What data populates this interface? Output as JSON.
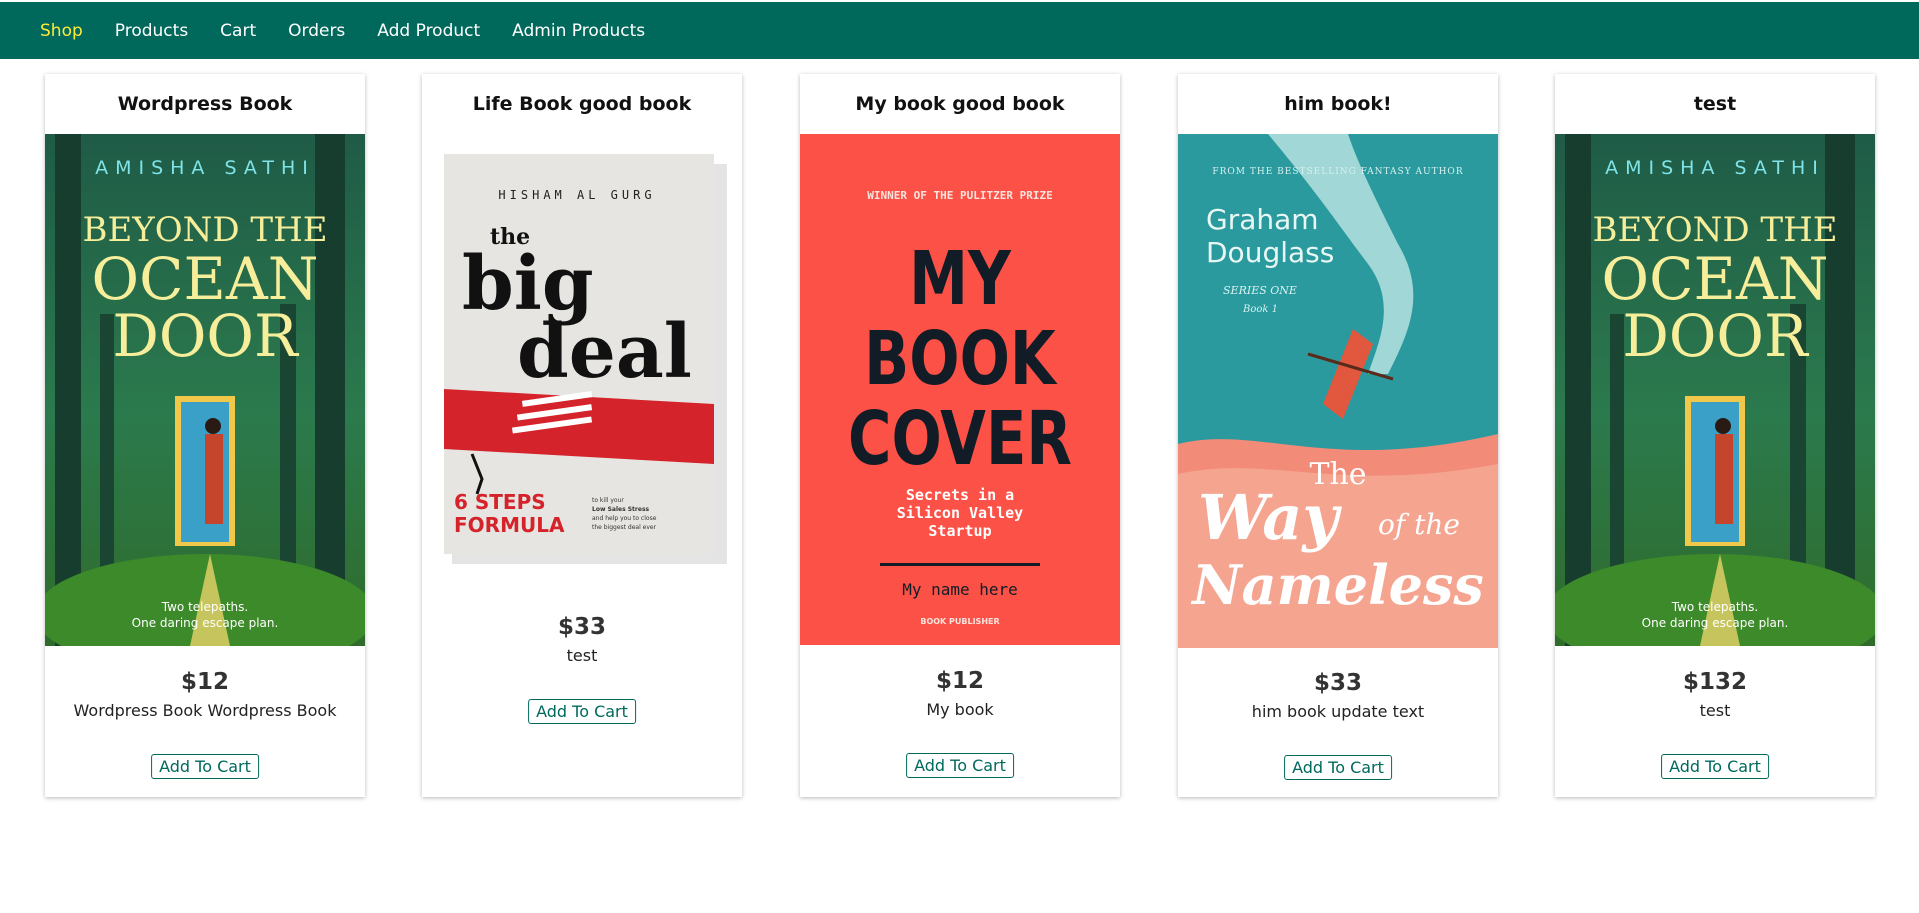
{
  "nav": {
    "items": [
      {
        "label": "Shop",
        "active": true
      },
      {
        "label": "Products",
        "active": false
      },
      {
        "label": "Cart",
        "active": false
      },
      {
        "label": "Orders",
        "active": false
      },
      {
        "label": "Add Product",
        "active": false
      },
      {
        "label": "Admin Products",
        "active": false
      }
    ]
  },
  "colors": {
    "navbar": "#00695c",
    "active_link": "#ffeb3b",
    "button": "#00695c"
  },
  "products": [
    {
      "title": "Wordpress Book",
      "price": "$12",
      "description": "Wordpress Book Wordpress Book",
      "button": "Add To Cart",
      "cover": {
        "author": "AMISHA SATHI",
        "line1": "BEYOND THE",
        "line2": "OCEAN",
        "line3": "DOOR",
        "tagline1": "Two telepaths.",
        "tagline2": "One daring escape plan."
      }
    },
    {
      "title": "Life Book good book",
      "price": "$33",
      "description": "test",
      "button": "Add To Cart",
      "cover": {
        "author": "HISHAM AL GURG",
        "line1": "the",
        "line2": "big",
        "line3": "deal",
        "sub1": "6 STEPS",
        "sub2": "FORMULA",
        "blurb1": "to kill your",
        "blurb2": "Low Sales Stress",
        "blurb3": "and help you to close",
        "blurb4": "the biggest deal ever"
      }
    },
    {
      "title": "My book good book",
      "price": "$12",
      "description": "My book",
      "button": "Add To Cart",
      "cover": {
        "award": "WINNER OF THE PULITZER PRIZE",
        "line1": "MY",
        "line2": "BOOK",
        "line3": "COVER",
        "sub1": "Secrets in a",
        "sub2": "Silicon Valley",
        "sub3": "Startup",
        "name": "My name here",
        "publisher": "BOOK PUBLISHER"
      }
    },
    {
      "title": "him book!",
      "price": "$33",
      "description": "him book update text",
      "button": "Add To Cart",
      "cover": {
        "blurb": "FROM THE BESTSELLING FANTASY AUTHOR",
        "author1": "Graham",
        "author2": "Douglass",
        "series": "SERIES ONE",
        "book": "Book 1",
        "line1": "The",
        "line2": "Way",
        "line2b": "of the",
        "line3": "Nameless"
      }
    },
    {
      "title": "test",
      "price": "$132",
      "description": "test",
      "button": "Add To Cart",
      "cover": {
        "author": "AMISHA SATHI",
        "line1": "BEYOND THE",
        "line2": "OCEAN",
        "line3": "DOOR",
        "tagline1": "Two telepaths.",
        "tagline2": "One daring escape plan."
      }
    }
  ]
}
